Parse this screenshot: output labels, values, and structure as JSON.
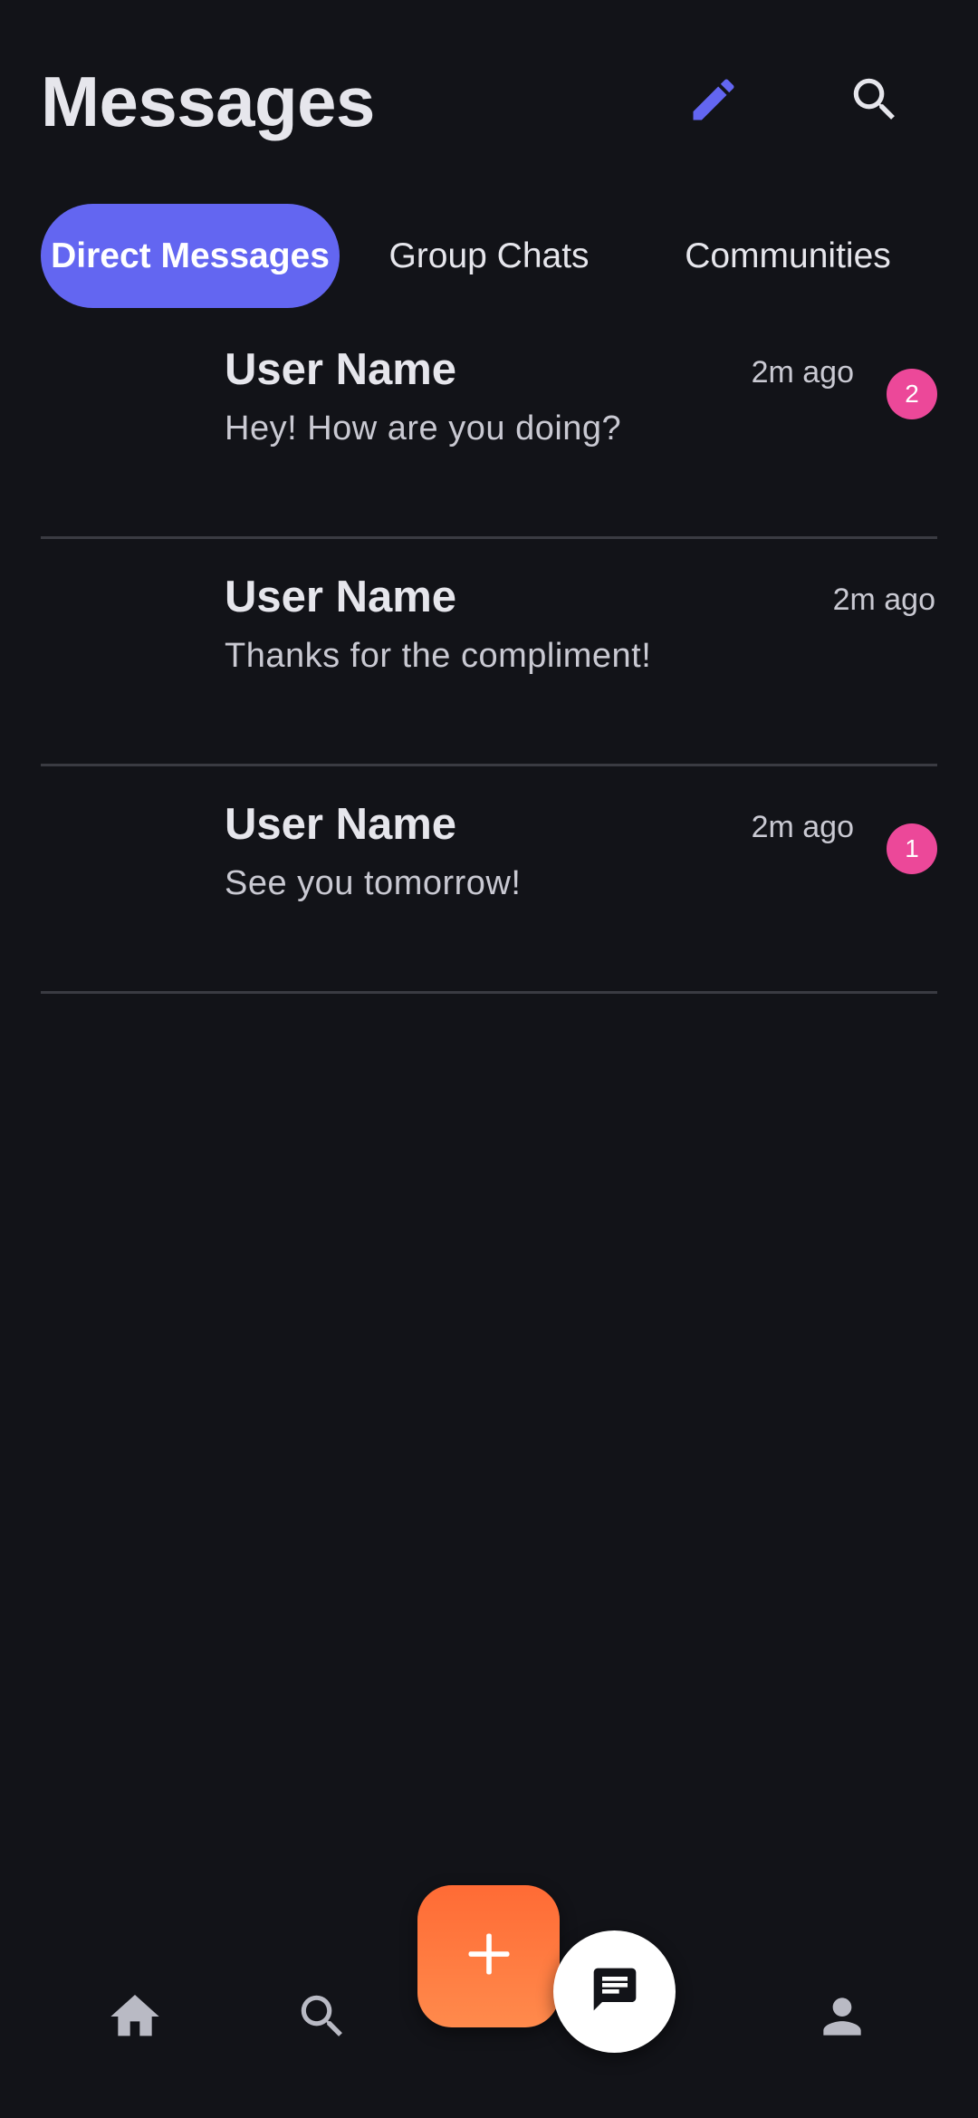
{
  "header": {
    "title": "Messages",
    "compose_icon": "pencil-icon",
    "search_icon": "search-icon"
  },
  "tabs": [
    {
      "label": "Direct Messages",
      "active": true
    },
    {
      "label": "Group Chats",
      "active": false
    },
    {
      "label": "Communities",
      "active": false
    }
  ],
  "conversations": [
    {
      "name": "User Name",
      "preview": "Hey! How are you doing?",
      "time": "2m ago",
      "unread": "2"
    },
    {
      "name": "User Name",
      "preview": "Thanks for the compliment!",
      "time": "2m ago",
      "unread": null
    },
    {
      "name": "User Name",
      "preview": "See you tomorrow!",
      "time": "2m ago",
      "unread": "1"
    }
  ],
  "bottom_nav": {
    "items": [
      "home-icon",
      "search-icon",
      "add-icon",
      "chat-icon",
      "profile-icon"
    ]
  },
  "colors": {
    "background": "#121318",
    "accent": "#6366f1",
    "badge": "#ec4899",
    "fab_add": "#ff6b35",
    "fab_chat": "#ffffff"
  }
}
